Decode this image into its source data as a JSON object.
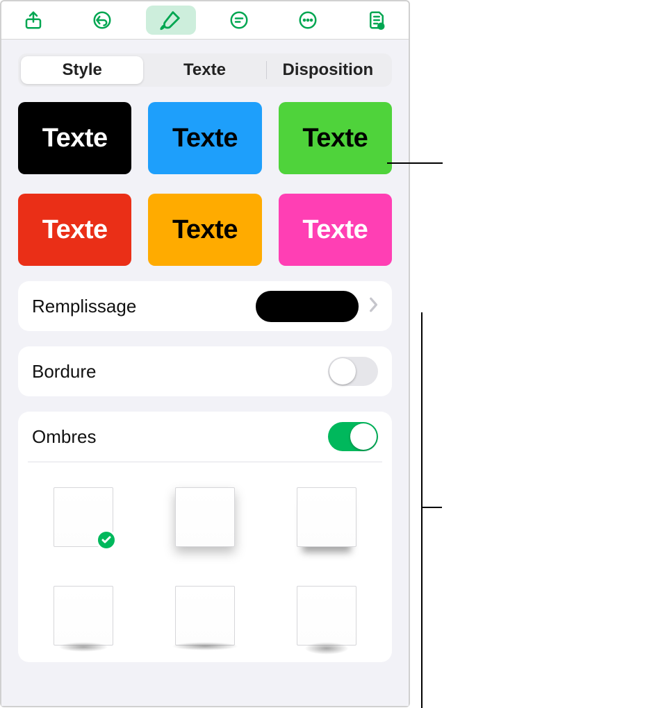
{
  "accent": "#00a651",
  "toolbar": {
    "icons": [
      "share",
      "undo",
      "brush",
      "list",
      "more",
      "doc"
    ],
    "active_index": 2
  },
  "tabs": {
    "items": [
      {
        "label": "Style"
      },
      {
        "label": "Texte"
      },
      {
        "label": "Disposition"
      }
    ],
    "selected": 0
  },
  "presets": [
    {
      "label": "Texte",
      "bg": "#000000",
      "fg": "#ffffff"
    },
    {
      "label": "Texte",
      "bg": "#1e9ffb",
      "fg": "#000000"
    },
    {
      "label": "Texte",
      "bg": "#4fd33b",
      "fg": "#000000"
    },
    {
      "label": "Texte",
      "bg": "#ea2f17",
      "fg": "#ffffff"
    },
    {
      "label": "Texte",
      "bg": "#ffab00",
      "fg": "#000000"
    },
    {
      "label": "Texte",
      "bg": "#ff3fb4",
      "fg": "#ffffff"
    }
  ],
  "fill": {
    "label": "Remplissage",
    "swatch": "#000000"
  },
  "border": {
    "label": "Bordure",
    "on": false
  },
  "shadow": {
    "label": "Ombres",
    "on": true,
    "options": [
      "none",
      "drop",
      "contact",
      "curlA",
      "curlB",
      "curlC"
    ],
    "selected": 0
  }
}
